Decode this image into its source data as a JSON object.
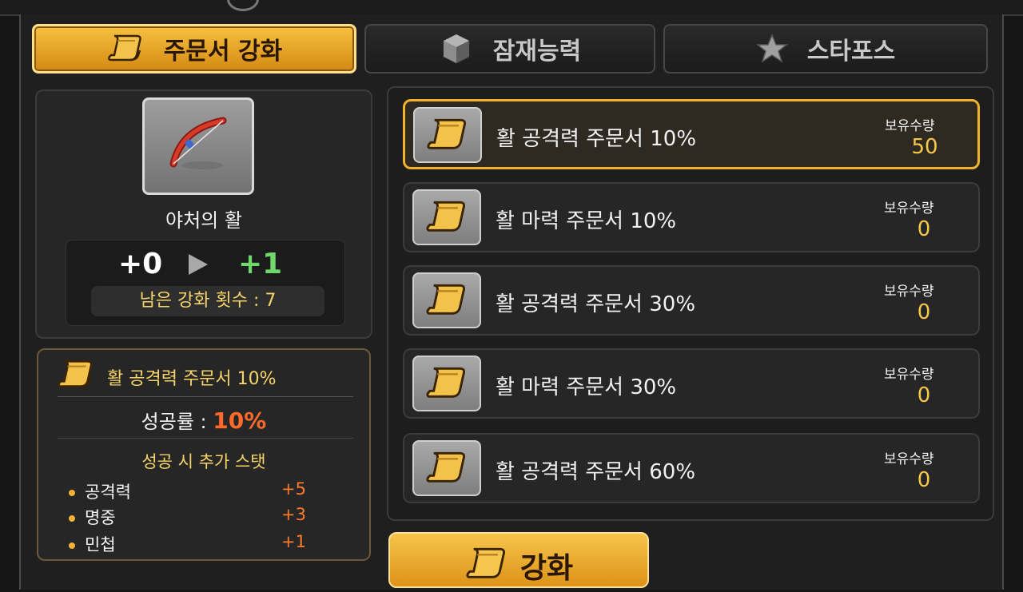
{
  "tabs": [
    {
      "label": "주문서 강화",
      "icon": "scroll-icon",
      "active": true
    },
    {
      "label": "잠재능력",
      "icon": "cube-icon",
      "active": false
    },
    {
      "label": "스타포스",
      "icon": "star-icon",
      "active": false
    }
  ],
  "item": {
    "name": "야처의 활",
    "icon": "bow-icon",
    "current_level": "+0",
    "next_level": "+1",
    "remaining": "남은 강화 횟수 : 7"
  },
  "selected_scroll": {
    "name": "활 공격력 주문서 10%",
    "rate_label": "성공률 :",
    "rate_value": "10%",
    "bonus_title": "성공 시 추가 스탯",
    "stats": [
      {
        "name": "공격력",
        "value": "+5"
      },
      {
        "name": "명중",
        "value": "+3"
      },
      {
        "name": "민첩",
        "value": "+1"
      }
    ]
  },
  "scrolls": [
    {
      "name": "활 공격력 주문서 10%",
      "owned_label": "보유수량",
      "owned": "50",
      "selected": true
    },
    {
      "name": "활 마력 주문서 10%",
      "owned_label": "보유수량",
      "owned": "0",
      "selected": false
    },
    {
      "name": "활 공격력 주문서 30%",
      "owned_label": "보유수량",
      "owned": "0",
      "selected": false
    },
    {
      "name": "활 마력 주문서 30%",
      "owned_label": "보유수량",
      "owned": "0",
      "selected": false
    },
    {
      "name": "활 공격력 주문서 60%",
      "owned_label": "보유수량",
      "owned": "0",
      "selected": false
    }
  ],
  "enhance_button": {
    "label": "강화"
  },
  "colors": {
    "accent": "#f2b22a",
    "success": "#6fd86a",
    "rate": "#ff6a2a",
    "gold_text": "#f6d46a"
  }
}
